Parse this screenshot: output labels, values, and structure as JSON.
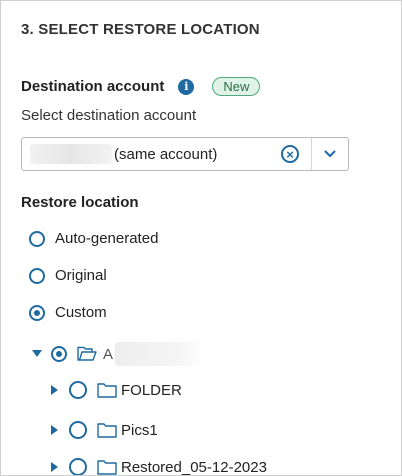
{
  "section": {
    "title": "3. SELECT RESTORE LOCATION"
  },
  "destination": {
    "label": "Destination account",
    "badge": "New",
    "caption": "Select destination account",
    "selected_value": "(same account)",
    "clear_icon": "clear-circle-icon",
    "dropdown_icon": "chevron-down-icon"
  },
  "restore": {
    "label": "Restore location",
    "options": [
      {
        "label": "Auto-generated",
        "checked": false
      },
      {
        "label": "Original",
        "checked": false
      },
      {
        "label": "Custom",
        "checked": true
      }
    ]
  },
  "tree": {
    "root": {
      "label_initial": "A",
      "expanded": true,
      "checked": true
    },
    "children": [
      {
        "label": "FOLDER",
        "checked": false
      },
      {
        "label": "Pics1",
        "checked": false
      },
      {
        "label": "Restored_05-12-2023",
        "checked": false
      }
    ]
  },
  "colors": {
    "accent": "#1f6aa1",
    "badge_bg": "#dff4e7",
    "badge_border": "#4fa87a"
  }
}
